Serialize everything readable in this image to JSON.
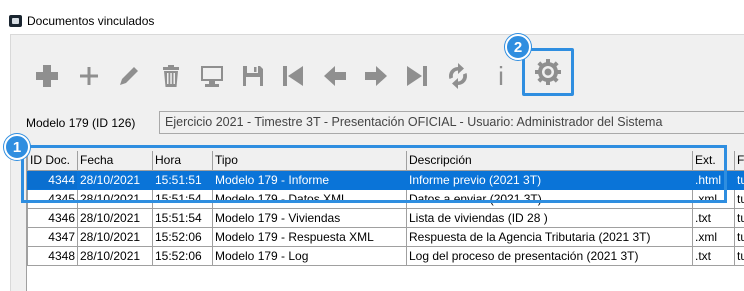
{
  "window": {
    "title": "Documentos vinculados"
  },
  "toolbar": {
    "buttons": [
      "add-bold-icon",
      "add-icon",
      "edit-icon",
      "delete-icon",
      "monitor-icon",
      "save-icon",
      "first-icon",
      "previous-icon",
      "next-icon",
      "last-icon",
      "refresh-icon",
      "info-icon",
      "settings-icon"
    ],
    "info_glyph": "i"
  },
  "callouts": {
    "grid": "1",
    "settings": "2"
  },
  "model": {
    "label": "Modelo 179 (ID 126)",
    "value": "Ejercicio 2021 - Timestre 3T - Presentación OFICIAL - Usuario: Administrador del Sistema"
  },
  "grid": {
    "columns": [
      "ID Doc.",
      "Fecha",
      "Hora",
      "Tipo",
      "Descripción",
      "Ext.",
      "Fi"
    ],
    "rows": [
      {
        "id": "4344",
        "fecha": "28/10/2021",
        "hora": "15:51:51",
        "tipo": "Modelo 179 - Informe",
        "descripcion": "Informe previo (2021 3T)",
        "ext": ".html",
        "fi": "tu",
        "selected": true
      },
      {
        "id": "4345",
        "fecha": "28/10/2021",
        "hora": "15:51:54",
        "tipo": "Modelo 179 - Datos XML",
        "descripcion": "Datos a enviar (2021 3T)",
        "ext": ".xml",
        "fi": "tu",
        "selected": false
      },
      {
        "id": "4346",
        "fecha": "28/10/2021",
        "hora": "15:51:54",
        "tipo": "Modelo 179 - Viviendas",
        "descripcion": "Lista de viviendas (ID 28 )",
        "ext": ".txt",
        "fi": "tu",
        "selected": false
      },
      {
        "id": "4347",
        "fecha": "28/10/2021",
        "hora": "15:52:06",
        "tipo": "Modelo 179 - Respuesta XML",
        "descripcion": "Respuesta de la Agencia Tributaria (2021 3T)",
        "ext": ".xml",
        "fi": "tu",
        "selected": false
      },
      {
        "id": "4348",
        "fecha": "28/10/2021",
        "hora": "15:52:06",
        "tipo": "Modelo 179 - Log",
        "descripcion": "Log del proceso de presentación (2021 3T)",
        "ext": ".txt",
        "fi": "tu",
        "selected": false
      }
    ]
  },
  "colors": {
    "accent": "#2f8ee0",
    "selection": "#0a74d8",
    "icon_gray": "#8f8f8f"
  }
}
